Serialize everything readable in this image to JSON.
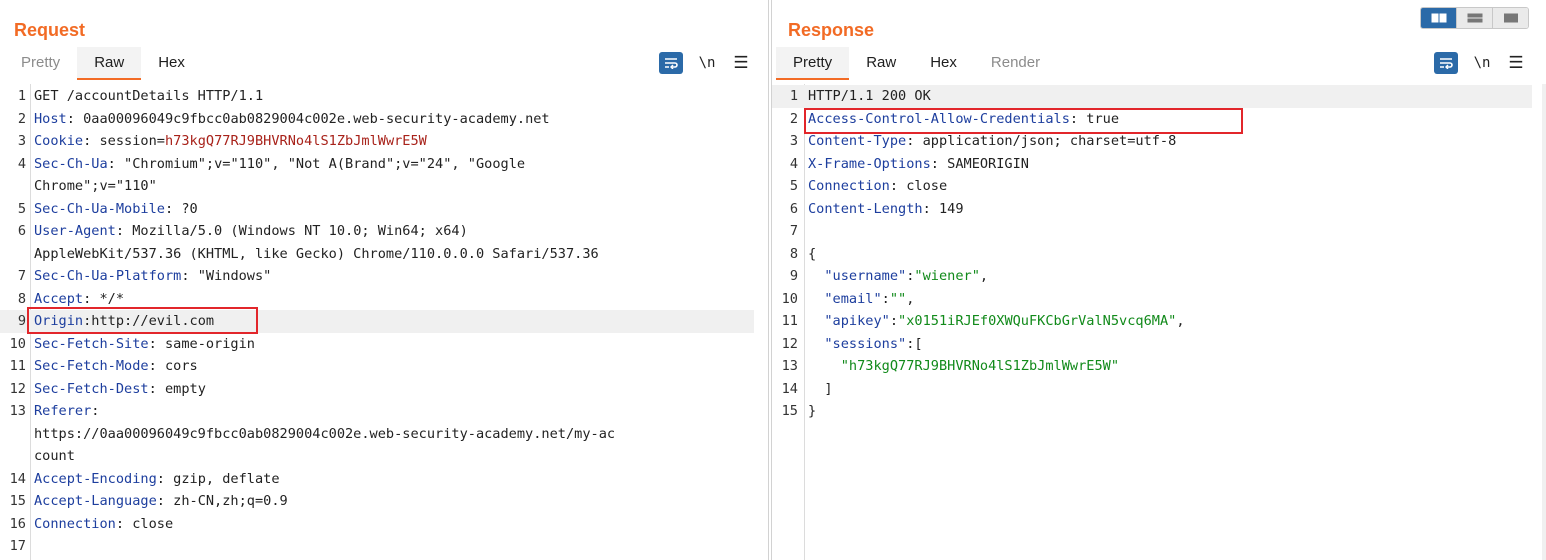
{
  "request": {
    "title": "Request",
    "tabs": [
      {
        "label": "Pretty",
        "state": "dim"
      },
      {
        "label": "Raw",
        "state": "active"
      },
      {
        "label": "Hex",
        "state": "normal"
      }
    ],
    "tools": {
      "wrap_icon": "wrap-lines-icon",
      "newline_label": "\\n",
      "menu_glyph": "☰"
    },
    "lines": [
      {
        "n": "1",
        "key": "",
        "sep": "",
        "val": "GET /accountDetails HTTP/1.1"
      },
      {
        "n": "2",
        "key": "Host",
        "sep": ": ",
        "val": "0aa00096049c9fbcc0ab0829004c002e.web-security-academy.net"
      },
      {
        "n": "3",
        "key": "Cookie",
        "sep": ": ",
        "val": "session=",
        "val2": "h73kgQ77RJ9BHVRNo4lS1ZbJmlWwrE5W"
      },
      {
        "n": "4",
        "key": "Sec-Ch-Ua",
        "sep": ": ",
        "val": "\"Chromium\";v=\"110\", \"Not A(Brand\";v=\"24\", \"Google"
      },
      {
        "n": "",
        "key": "",
        "sep": "",
        "val": "Chrome\";v=\"110\""
      },
      {
        "n": "5",
        "key": "Sec-Ch-Ua-Mobile",
        "sep": ": ",
        "val": "?0"
      },
      {
        "n": "6",
        "key": "User-Agent",
        "sep": ": ",
        "val": "Mozilla/5.0 (Windows NT 10.0; Win64; x64)"
      },
      {
        "n": "",
        "key": "",
        "sep": "",
        "val": "AppleWebKit/537.36 (KHTML, like Gecko) Chrome/110.0.0.0 Safari/537.36"
      },
      {
        "n": "7",
        "key": "Sec-Ch-Ua-Platform",
        "sep": ": ",
        "val": "\"Windows\""
      },
      {
        "n": "8",
        "key": "Accept",
        "sep": ": ",
        "val": "*/*"
      },
      {
        "n": "9",
        "key": "Origin",
        "sep": ":",
        "val": "http://evil.com",
        "hl": true
      },
      {
        "n": "10",
        "key": "Sec-Fetch-Site",
        "sep": ": ",
        "val": "same-origin"
      },
      {
        "n": "11",
        "key": "Sec-Fetch-Mode",
        "sep": ": ",
        "val": "cors"
      },
      {
        "n": "12",
        "key": "Sec-Fetch-Dest",
        "sep": ": ",
        "val": "empty"
      },
      {
        "n": "13",
        "key": "Referer",
        "sep": ":",
        "val": ""
      },
      {
        "n": "",
        "key": "",
        "sep": "",
        "val": "https://0aa00096049c9fbcc0ab0829004c002e.web-security-academy.net/my-ac"
      },
      {
        "n": "",
        "key": "",
        "sep": "",
        "val": "count"
      },
      {
        "n": "14",
        "key": "Accept-Encoding",
        "sep": ": ",
        "val": "gzip, deflate"
      },
      {
        "n": "15",
        "key": "Accept-Language",
        "sep": ": ",
        "val": "zh-CN,zh;q=0.9"
      },
      {
        "n": "16",
        "key": "Connection",
        "sep": ": ",
        "val": "close"
      },
      {
        "n": "17",
        "key": "",
        "sep": "",
        "val": ""
      }
    ]
  },
  "response": {
    "title": "Response",
    "tabs": [
      {
        "label": "Pretty",
        "state": "active"
      },
      {
        "label": "Raw",
        "state": "normal"
      },
      {
        "label": "Hex",
        "state": "normal"
      },
      {
        "label": "Render",
        "state": "dim"
      }
    ],
    "tools": {
      "wrap_icon": "wrap-lines-icon",
      "newline_label": "\\n",
      "menu_glyph": "☰"
    },
    "lines": [
      {
        "n": "1",
        "key": "",
        "sep": "",
        "val": "HTTP/1.1 200 OK",
        "hl": true
      },
      {
        "n": "2",
        "key": "Access-Control-Allow-Credentials",
        "sep": ": ",
        "val": "true"
      },
      {
        "n": "3",
        "key": "Content-Type",
        "sep": ": ",
        "val": "application/json; charset=utf-8"
      },
      {
        "n": "4",
        "key": "X-Frame-Options",
        "sep": ": ",
        "val": "SAMEORIGIN"
      },
      {
        "n": "5",
        "key": "Connection",
        "sep": ": ",
        "val": "close"
      },
      {
        "n": "6",
        "key": "Content-Length",
        "sep": ": ",
        "val": "149"
      },
      {
        "n": "7",
        "key": "",
        "sep": "",
        "val": ""
      },
      {
        "n": "8",
        "key": "",
        "sep": "",
        "val": "{"
      },
      {
        "n": "9",
        "jkey": "\"username\"",
        "jsep": ":",
        "jval": "\"wiener\"",
        "tail": ",",
        "indent": "  "
      },
      {
        "n": "10",
        "jkey": "\"email\"",
        "jsep": ":",
        "jval": "\"\"",
        "tail": ",",
        "indent": "  "
      },
      {
        "n": "11",
        "jkey": "\"apikey\"",
        "jsep": ":",
        "jval": "\"x0151iRJEf0XWQuFKCbGrValN5vcq6MA\"",
        "tail": ",",
        "indent": "  "
      },
      {
        "n": "12",
        "jkey": "\"sessions\"",
        "jsep": ":",
        "jval": "",
        "tail": "[",
        "indent": "  "
      },
      {
        "n": "13",
        "jkey": "",
        "jsep": "",
        "jval": "\"h73kgQ77RJ9BHVRNo4lS1ZbJmlWwrE5W\"",
        "tail": "",
        "indent": "    "
      },
      {
        "n": "14",
        "key": "",
        "sep": "",
        "val": "  ]"
      },
      {
        "n": "15",
        "key": "",
        "sep": "",
        "val": "}"
      }
    ]
  },
  "layout_switch": {
    "options": [
      "side-by-side",
      "stacked",
      "tabs"
    ],
    "active": 0
  }
}
